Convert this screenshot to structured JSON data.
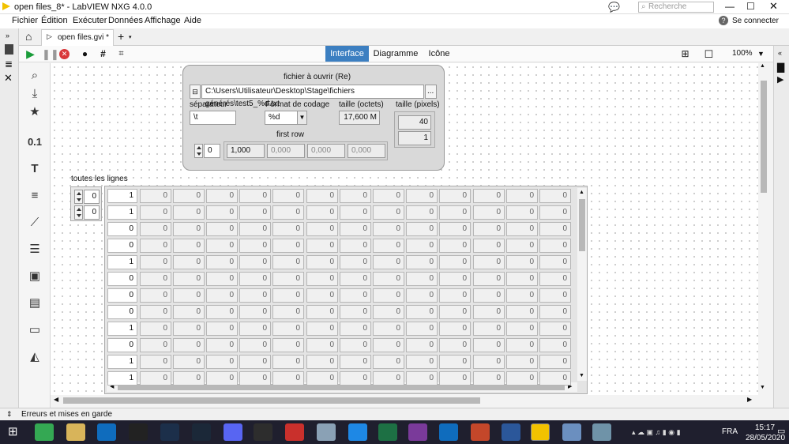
{
  "window": {
    "title": "open files_8* - LabVIEW NXG 4.0.0"
  },
  "header": {
    "search_placeholder": "Recherche",
    "signin": "Se connecter"
  },
  "menu": [
    "Fichier",
    "Édition",
    "Exécuter",
    "Données",
    "Affichage",
    "Aide"
  ],
  "tabs": {
    "document": "open files.gvi *"
  },
  "view_tabs": [
    "Interface",
    "Diagramme",
    "Icône"
  ],
  "active_view": "Interface",
  "zoom": "100%",
  "palette_labels": {
    "numeric": "0.1"
  },
  "panel": {
    "file_label": "fichier à ouvrir (Re)",
    "file_path": "C:\\Users\\Utilisateur\\Desktop\\Stage\\fichiers générés\\test5_%d.txt",
    "browse_label": "...",
    "separator_label": "séparateur",
    "separator_value": "\\t",
    "format_label": "Format de codage",
    "format_value": "%d",
    "size_bytes_label": "taille (octets)",
    "size_bytes_value": "17,600 M",
    "size_pixels_label": "taille (pixels)",
    "size_pixels_values": [
      "40",
      "1"
    ],
    "first_row_label": "first row",
    "first_row_index": "0",
    "first_row_values": [
      "1,000",
      "0,000",
      "0,000",
      "0,000"
    ]
  },
  "table": {
    "label": "toutes les lignes",
    "index_row": "0",
    "index_col": "0",
    "first_col": [
      "1",
      "1",
      "0",
      "0",
      "1",
      "0",
      "0",
      "0",
      "1",
      "0",
      "1",
      "1"
    ],
    "other_value": "0"
  },
  "status": {
    "text": "Erreurs et mises en garde"
  },
  "system": {
    "lang": "FRA",
    "time": "15:17",
    "date": "28/05/2020"
  },
  "colors": {
    "accent": "#3c7fc1",
    "run": "#1a9c3a",
    "abort": "#d9383a",
    "taskbar": "#1f1f2e"
  }
}
